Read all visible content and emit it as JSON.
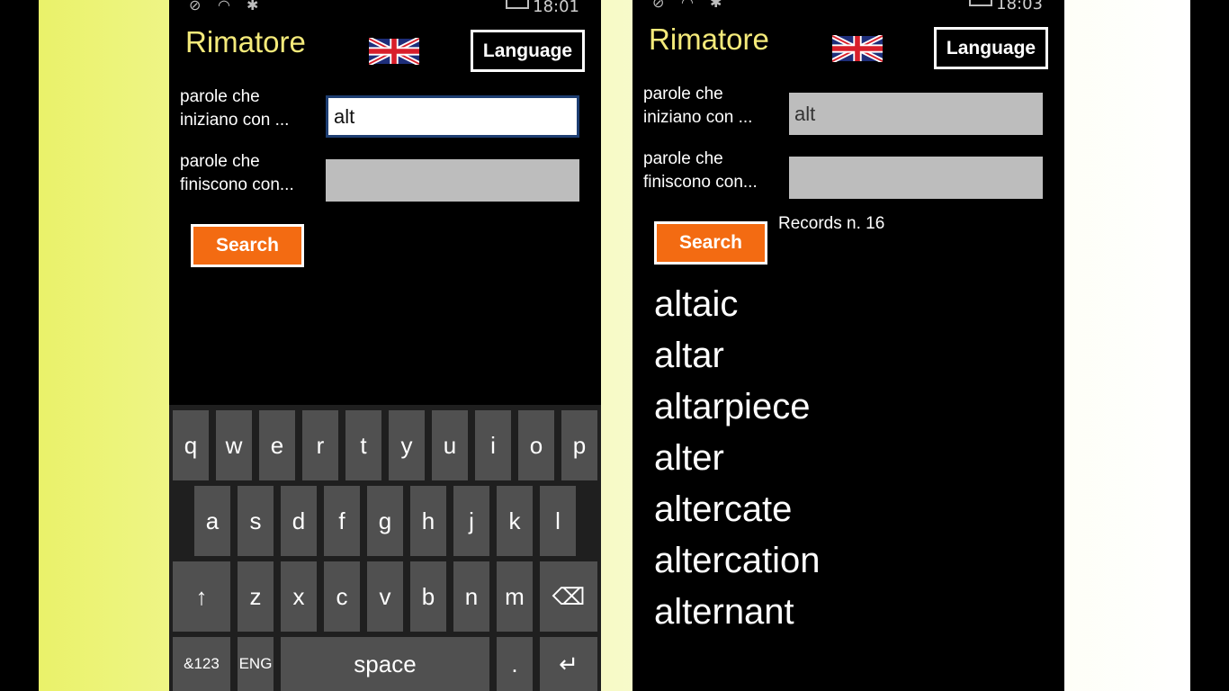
{
  "left": {
    "status": {
      "time": "18:01"
    },
    "title": "Rimatore",
    "language_label": "Language",
    "starts_label": [
      "parole che",
      "iniziano con ..."
    ],
    "ends_label": [
      "parole che",
      "finiscono con..."
    ],
    "starts_value": "alt",
    "ends_value": "",
    "search_label": "Search",
    "keyboard": {
      "row1": [
        "q",
        "w",
        "e",
        "r",
        "t",
        "y",
        "u",
        "i",
        "o",
        "p"
      ],
      "row2": [
        "a",
        "s",
        "d",
        "f",
        "g",
        "h",
        "j",
        "k",
        "l"
      ],
      "row3": [
        "z",
        "x",
        "c",
        "v",
        "b",
        "n",
        "m"
      ],
      "shift": "↑",
      "backspace": "⌫",
      "numbers": "&123",
      "lang": "ENG",
      "space": "space",
      "period": ".",
      "enter": "↵"
    }
  },
  "right": {
    "status": {
      "time": "18:03"
    },
    "title": "Rimatore",
    "language_label": "Language",
    "starts_label": [
      "parole che",
      "iniziano con ..."
    ],
    "ends_label": [
      "parole che",
      "finiscono con..."
    ],
    "starts_value": "alt",
    "ends_value": "",
    "search_label": "Search",
    "records_label": "Records n. 16",
    "results": [
      "altaic",
      "altar",
      "altarpiece",
      "alter",
      "altercate",
      "altercation",
      "alternant"
    ]
  },
  "colors": {
    "title": "#f4ea7a",
    "search_button": "#f36b12",
    "input_idle": "#bdbdbd",
    "input_focus_border": "#1e3e72",
    "key": "#505050"
  },
  "icons": {
    "flag": "uk-flag-icon",
    "status": [
      "sync-icon",
      "wifi-icon",
      "bluetooth-icon",
      "battery-icon"
    ]
  }
}
